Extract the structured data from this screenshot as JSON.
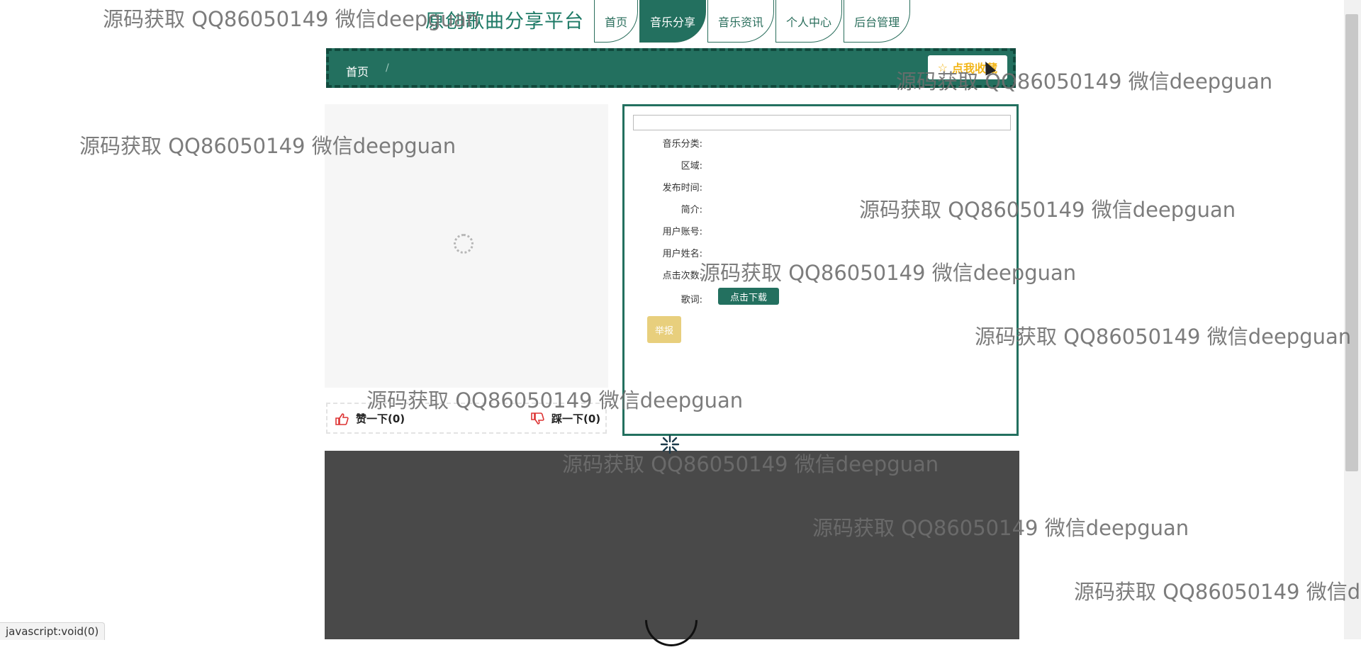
{
  "site": {
    "title": "原创歌曲分享平台"
  },
  "nav": {
    "tabs": [
      {
        "label": "首页",
        "active": false
      },
      {
        "label": "音乐分享",
        "active": true
      },
      {
        "label": "音乐资讯",
        "active": false
      },
      {
        "label": "个人中心",
        "active": false
      },
      {
        "label": "后台管理",
        "active": false
      }
    ]
  },
  "breadcrumb": {
    "home": "首页",
    "separator": "/"
  },
  "favorite": {
    "label": "点我收藏",
    "icon": "star-icon"
  },
  "votes": {
    "like": {
      "label": "赞一下(0)",
      "icon": "thumbs-up-icon"
    },
    "dislike": {
      "label": "踩一下(0)",
      "icon": "thumbs-down-icon"
    }
  },
  "details": {
    "title_value": "",
    "fields": [
      {
        "label": "音乐分类:",
        "value": ""
      },
      {
        "label": "区域:",
        "value": ""
      },
      {
        "label": "发布时间:",
        "value": ""
      },
      {
        "label": "简介:",
        "value": ""
      },
      {
        "label": "用户账号:",
        "value": ""
      },
      {
        "label": "用户姓名:",
        "value": ""
      },
      {
        "label": "点击次数:",
        "value": ""
      }
    ],
    "lyrics_label": "歌词:",
    "download_label": "点击下载",
    "report_label": "举报"
  },
  "status_bar": {
    "text": "javascript:void(0)"
  },
  "watermark": {
    "text": "源码获取 QQ86050149 微信deepguan"
  },
  "colors": {
    "primary": "#23705f",
    "report": "#e8cf7d",
    "favorite": "#f2b61a",
    "video_bg": "#494949"
  }
}
